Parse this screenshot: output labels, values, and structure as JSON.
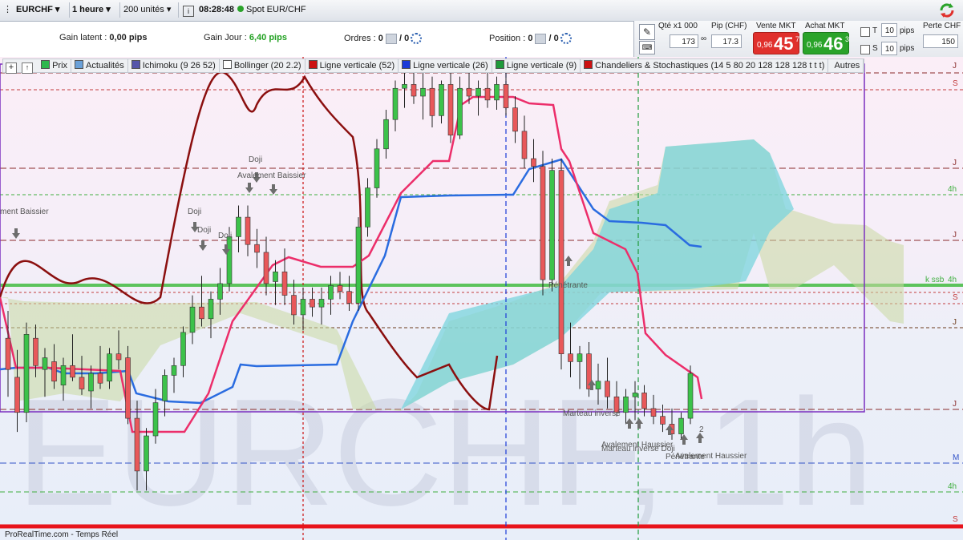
{
  "toolbar": {
    "symbol": "EURCHF",
    "timeframe": "1 heure",
    "units": "200 unités",
    "time": "08:28:48",
    "instrument": "Spot EUR/CHF"
  },
  "account": {
    "gain_latent_label": "Gain latent :",
    "gain_latent_value": "0,00 pips",
    "gain_jour_label": "Gain Jour :",
    "gain_jour_value": "6,40 pips",
    "ordres_label": "Ordres :",
    "ordres_a": "0",
    "ordres_b": "/ 0",
    "position_label": "Position :",
    "position_a": "0",
    "position_b": "/ 0"
  },
  "order_panel": {
    "qty_label": "Qté x1 000",
    "qty_value": "173",
    "pip_label": "Pip (CHF)",
    "pip_value": "17.3",
    "sell_label": "Vente MKT",
    "sell_small": "0,96",
    "sell_big": "45",
    "sell_sup": "7",
    "buy_label": "Achat MKT",
    "buy_small": "0,96",
    "buy_big": "46",
    "buy_sup": "3",
    "t_label": "T",
    "t_value": "10",
    "s_label": "S",
    "s_value": "10",
    "pips_label": "pips",
    "perte_label": "Perte CHF",
    "perte_value": "150",
    "colors": {
      "sell": "#e0302c",
      "buy": "#2aa32a"
    }
  },
  "legend": [
    {
      "label": "Prix",
      "color": "#2db84d"
    },
    {
      "label": "Actualités",
      "color": "#6aa0d8"
    },
    {
      "label": "Ichimoku (9 26 52)",
      "color": "#5555aa"
    },
    {
      "label": "Bollinger (20 2.2)",
      "color": "#ffffff"
    },
    {
      "label": "Ligne verticale (52)",
      "color": "#cc1111"
    },
    {
      "label": "Ligne verticale (26)",
      "color": "#1a3ad8"
    },
    {
      "label": "Ligne verticale (9)",
      "color": "#1f9a3a"
    },
    {
      "label": "Chandeliers & Stochastiques (14 5 80 20 128 128 128 t t t)",
      "color": "#cc1111"
    }
  ],
  "legend_more": "Autres",
  "watermark": "EURCHF, 1h",
  "footer": "ProRealTime.com - Temps Réel",
  "right_labels": [
    "J",
    "S",
    "J",
    "4h",
    "J",
    "k ssb",
    "4h",
    "S",
    "J",
    "J",
    "M",
    "4h",
    "S"
  ],
  "patterns": [
    "Doji",
    "Avalement Baissier",
    "ment Baissier",
    "Doji",
    "Doji",
    "Doji",
    "Pénétrante",
    "Marteau inversé",
    "Avalement Haussier",
    "Marteau inversé Doji",
    "Pénétrante",
    "Avalement Haussier",
    "2"
  ],
  "chart_data": {
    "type": "candlestick",
    "candles": [
      [
        0,
        0.9738,
        0.9752,
        0.9708,
        0.9722
      ],
      [
        1,
        0.9718,
        0.9732,
        0.969,
        0.97
      ],
      [
        2,
        0.97,
        0.9746,
        0.9695,
        0.974
      ],
      [
        3,
        0.9738,
        0.9745,
        0.9718,
        0.9724
      ],
      [
        4,
        0.9722,
        0.9733,
        0.9708,
        0.9728
      ],
      [
        5,
        0.9726,
        0.9735,
        0.9712,
        0.9716
      ],
      [
        6,
        0.9714,
        0.9728,
        0.9706,
        0.9724
      ],
      [
        7,
        0.9724,
        0.974,
        0.9716,
        0.9718
      ],
      [
        8,
        0.9718,
        0.9729,
        0.9709,
        0.9712
      ],
      [
        9,
        0.9711,
        0.9724,
        0.9702,
        0.972
      ],
      [
        10,
        0.972,
        0.9734,
        0.9712,
        0.9715
      ],
      [
        11,
        0.9716,
        0.9733,
        0.9712,
        0.973
      ],
      [
        12,
        0.973,
        0.9742,
        0.9722,
        0.9727
      ],
      [
        13,
        0.9728,
        0.9734,
        0.9694,
        0.9697
      ],
      [
        14,
        0.9697,
        0.9706,
        0.966,
        0.967
      ],
      [
        15,
        0.967,
        0.9692,
        0.966,
        0.9688
      ],
      [
        16,
        0.9688,
        0.9712,
        0.9684,
        0.9705
      ],
      [
        17,
        0.9706,
        0.9722,
        0.9698,
        0.9719
      ],
      [
        18,
        0.9719,
        0.9728,
        0.971,
        0.9724
      ],
      [
        19,
        0.9724,
        0.9744,
        0.9718,
        0.9741
      ],
      [
        20,
        0.9741,
        0.976,
        0.9735,
        0.9754
      ],
      [
        21,
        0.9754,
        0.977,
        0.9744,
        0.9748
      ],
      [
        22,
        0.9748,
        0.9762,
        0.9738,
        0.9758
      ],
      [
        23,
        0.9758,
        0.9774,
        0.975,
        0.9766
      ],
      [
        24,
        0.9766,
        0.9795,
        0.9762,
        0.979
      ],
      [
        25,
        0.979,
        0.9806,
        0.9782,
        0.98
      ],
      [
        26,
        0.98,
        0.9806,
        0.978,
        0.9786
      ],
      [
        27,
        0.9786,
        0.9794,
        0.9774,
        0.9782
      ],
      [
        28,
        0.9782,
        0.979,
        0.976,
        0.9766
      ],
      [
        29,
        0.9767,
        0.9778,
        0.9755,
        0.9772
      ],
      [
        30,
        0.9772,
        0.9784,
        0.9755,
        0.976
      ],
      [
        31,
        0.976,
        0.9768,
        0.9745,
        0.975
      ],
      [
        32,
        0.975,
        0.9764,
        0.9742,
        0.9758
      ],
      [
        33,
        0.9758,
        0.9764,
        0.9749,
        0.9754
      ],
      [
        34,
        0.9754,
        0.9764,
        0.9745,
        0.9758
      ],
      [
        35,
        0.9758,
        0.977,
        0.975,
        0.9765
      ],
      [
        36,
        0.9765,
        0.9772,
        0.9758,
        0.9762
      ],
      [
        37,
        0.9762,
        0.977,
        0.9752,
        0.9756
      ],
      [
        38,
        0.9756,
        0.98,
        0.9752,
        0.9795
      ],
      [
        39,
        0.9795,
        0.982,
        0.979,
        0.9815
      ],
      [
        40,
        0.9815,
        0.984,
        0.981,
        0.9835
      ],
      [
        41,
        0.9835,
        0.9855,
        0.983,
        0.985
      ],
      [
        42,
        0.985,
        0.987,
        0.9844,
        0.9866
      ],
      [
        43,
        0.9866,
        0.9874,
        0.9856,
        0.9868
      ],
      [
        44,
        0.9868,
        0.9874,
        0.9858,
        0.9862
      ],
      [
        45,
        0.9862,
        0.9874,
        0.985,
        0.9866
      ],
      [
        46,
        0.9866,
        0.9872,
        0.9846,
        0.9852
      ],
      [
        47,
        0.9852,
        0.987,
        0.9848,
        0.9868
      ],
      [
        48,
        0.9868,
        0.9874,
        0.9838,
        0.9842
      ],
      [
        49,
        0.9842,
        0.9872,
        0.984,
        0.9866
      ],
      [
        50,
        0.9866,
        0.9874,
        0.9858,
        0.9862
      ],
      [
        51,
        0.9862,
        0.987,
        0.9852,
        0.9866
      ],
      [
        52,
        0.9866,
        0.9874,
        0.9856,
        0.986
      ],
      [
        53,
        0.986,
        0.9872,
        0.9855,
        0.9868
      ],
      [
        54,
        0.9868,
        0.9874,
        0.9852,
        0.9856
      ],
      [
        55,
        0.9856,
        0.9862,
        0.9838,
        0.9844
      ],
      [
        56,
        0.9844,
        0.9852,
        0.9825,
        0.983
      ],
      [
        57,
        0.983,
        0.984,
        0.9818,
        0.9826
      ],
      [
        58,
        0.9826,
        0.9834,
        0.976,
        0.9768
      ],
      [
        59,
        0.9768,
        0.983,
        0.9762,
        0.9824
      ],
      [
        60,
        0.9824,
        0.983,
        0.9722,
        0.973
      ],
      [
        61,
        0.973,
        0.9746,
        0.9718,
        0.9726
      ],
      [
        62,
        0.9726,
        0.9734,
        0.9712,
        0.973
      ],
      [
        63,
        0.973,
        0.9736,
        0.9708,
        0.9712
      ],
      [
        64,
        0.9712,
        0.9725,
        0.9704,
        0.9716
      ],
      [
        65,
        0.9716,
        0.9728,
        0.9702,
        0.9708
      ],
      [
        66,
        0.9708,
        0.9716,
        0.9698,
        0.97
      ],
      [
        67,
        0.97,
        0.9712,
        0.9694,
        0.9708
      ],
      [
        68,
        0.9708,
        0.9716,
        0.9696,
        0.971
      ],
      [
        69,
        0.971,
        0.9714,
        0.9698,
        0.9702
      ],
      [
        70,
        0.9702,
        0.9709,
        0.9694,
        0.9698
      ],
      [
        71,
        0.9698,
        0.9704,
        0.969,
        0.9694
      ],
      [
        72,
        0.9694,
        0.9702,
        0.9686,
        0.9689
      ],
      [
        73,
        0.9689,
        0.97,
        0.9686,
        0.9697
      ],
      [
        74,
        0.9697,
        0.9724,
        0.9694,
        0.972
      ]
    ],
    "ylim": [
      0.964,
      0.9878
    ],
    "grid": false
  }
}
